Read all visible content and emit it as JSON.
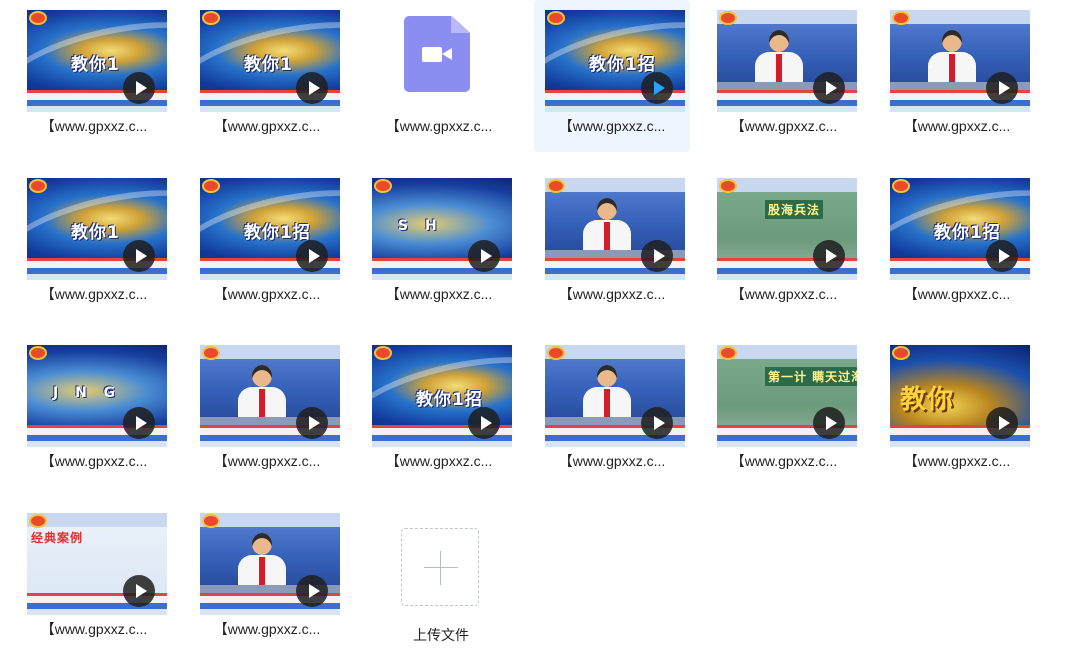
{
  "files": [
    {
      "name": "【www.gpxxz.c...",
      "kind": "video",
      "style": "swirl",
      "overlay": "教你1"
    },
    {
      "name": "【www.gpxxz.c...",
      "kind": "video",
      "style": "swirl",
      "overlay": "教你1"
    },
    {
      "name": "【www.gpxxz.c...",
      "kind": "video-icon",
      "style": "",
      "overlay": ""
    },
    {
      "name": "【www.gpxxz.c...",
      "kind": "video",
      "style": "swirl",
      "overlay": "教你1招",
      "selected": true
    },
    {
      "name": "【www.gpxxz.c...",
      "kind": "video",
      "style": "studio",
      "overlay": ""
    },
    {
      "name": "【www.gpxxz.c...",
      "kind": "video",
      "style": "studio",
      "overlay": ""
    },
    {
      "name": "【www.gpxxz.c...",
      "kind": "video",
      "style": "swirl",
      "overlay": "教你1"
    },
    {
      "name": "【www.gpxxz.c...",
      "kind": "video",
      "style": "swirl",
      "overlay": "教你1招"
    },
    {
      "name": "【www.gpxxz.c...",
      "kind": "video",
      "style": "stars",
      "overlay": "S H"
    },
    {
      "name": "【www.gpxxz.c...",
      "kind": "video",
      "style": "studio",
      "overlay": ""
    },
    {
      "name": "【www.gpxxz.c...",
      "kind": "video",
      "style": "board",
      "overlay": "股海兵法"
    },
    {
      "name": "【www.gpxxz.c...",
      "kind": "video",
      "style": "swirl",
      "overlay": "教你1招"
    },
    {
      "name": "【www.gpxxz.c...",
      "kind": "video",
      "style": "stars",
      "overlay": "J N G"
    },
    {
      "name": "【www.gpxxz.c...",
      "kind": "video",
      "style": "studio",
      "overlay": ""
    },
    {
      "name": "【www.gpxxz.c...",
      "kind": "video",
      "style": "swirl",
      "overlay": "教你1招"
    },
    {
      "name": "【www.gpxxz.c...",
      "kind": "video",
      "style": "studio",
      "overlay": ""
    },
    {
      "name": "【www.gpxxz.c...",
      "kind": "video",
      "style": "board",
      "overlay": "第一计 瞒天过海"
    },
    {
      "name": "【www.gpxxz.c...",
      "kind": "video",
      "style": "gold",
      "overlay": "教你"
    },
    {
      "name": "【www.gpxxz.c...",
      "kind": "video",
      "style": "chart",
      "overlay": "经典案例"
    },
    {
      "name": "【www.gpxxz.c...",
      "kind": "video",
      "style": "studio",
      "overlay": ""
    }
  ],
  "upload": {
    "label": "上传文件",
    "icon": "plus-icon"
  },
  "colors": {
    "selected_bg": "#eef5fd",
    "video_icon": "#8b8df0",
    "play_active": "#2aa0ff"
  }
}
